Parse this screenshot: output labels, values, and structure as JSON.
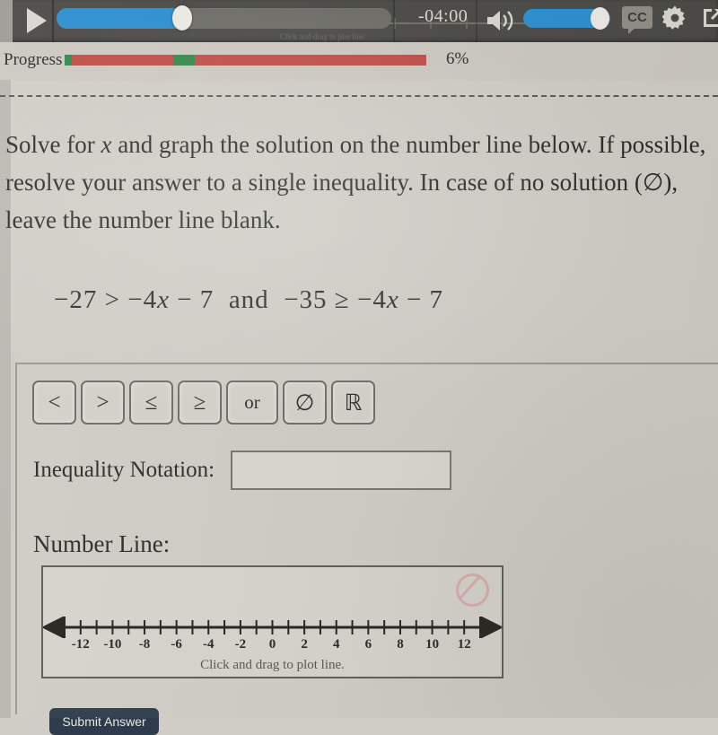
{
  "player": {
    "play_icon": "play-triangle-icon",
    "time_remaining": "-04:00",
    "volume_icon": "speaker-icon",
    "cc_label": "CC",
    "gear_icon": "gear-icon",
    "popout_icon": "popout-icon",
    "scrub_percent": 40,
    "volume_percent": 78
  },
  "progress": {
    "label": "Progress",
    "percent_text": "6%",
    "bar_color": "#bf4c45",
    "segment_color": "#2e8a4a",
    "segments": [
      {
        "left_pct": 0,
        "width_pct": 2
      },
      {
        "left_pct": 30,
        "width_pct": 6
      }
    ]
  },
  "question": {
    "line1_a": "Solve for ",
    "line1_var": "x",
    "line1_b": " and graph the solution on the number line below. If possible, resolve your answer to a single inequality. In case of no solution (∅), leave the number line blank."
  },
  "equation": {
    "text": "−27 > −4x − 7  and  −35 ≥ −4x − 7",
    "left_const": "−27",
    "left_rel": ">",
    "left_expr": "−4x − 7",
    "conjunction": "and",
    "right_const": "−35",
    "right_rel": "≥",
    "right_expr": "−4x − 7"
  },
  "answer": {
    "operator_buttons": [
      {
        "label": "<",
        "name": "less-than"
      },
      {
        "label": ">",
        "name": "greater-than"
      },
      {
        "label": "≤",
        "name": "less-than-or-equal"
      },
      {
        "label": "≥",
        "name": "greater-than-or-equal"
      },
      {
        "label": "or",
        "name": "or"
      },
      {
        "label": "∅",
        "name": "empty-set"
      },
      {
        "label": "ℝ",
        "name": "real-numbers"
      }
    ],
    "inequality_label": "Inequality Notation:",
    "inequality_value": "",
    "inequality_placeholder": "",
    "number_line_label": "Number Line:",
    "number_line_hint": "Click and drag to plot line.",
    "null_icon": "no-solution-circle-slash-icon"
  },
  "number_line": {
    "min": -13,
    "max": 13,
    "tick_step": 1,
    "labels": [
      {
        "value": -12,
        "text": "-12"
      },
      {
        "value": -10,
        "text": "-10"
      },
      {
        "value": -8,
        "text": "-8"
      },
      {
        "value": -6,
        "text": "-6"
      },
      {
        "value": -4,
        "text": "-4"
      },
      {
        "value": -2,
        "text": "-2"
      },
      {
        "value": 0,
        "text": "0"
      },
      {
        "value": 2,
        "text": "2"
      },
      {
        "value": 4,
        "text": "4"
      },
      {
        "value": 6,
        "text": "6"
      },
      {
        "value": 8,
        "text": "8"
      },
      {
        "value": 10,
        "text": "10"
      },
      {
        "value": 12,
        "text": "12"
      }
    ]
  },
  "submit": {
    "label": "Submit Answer"
  },
  "colors": {
    "page_bg": "#cfcdc5",
    "player_bg": "#4b4a46",
    "accent_blue": "#2b8fd0",
    "progress_red": "#bf4c45",
    "progress_green": "#2e8a4a",
    "text": "#2a2a28",
    "submit_bg": "#2d3b4c"
  }
}
